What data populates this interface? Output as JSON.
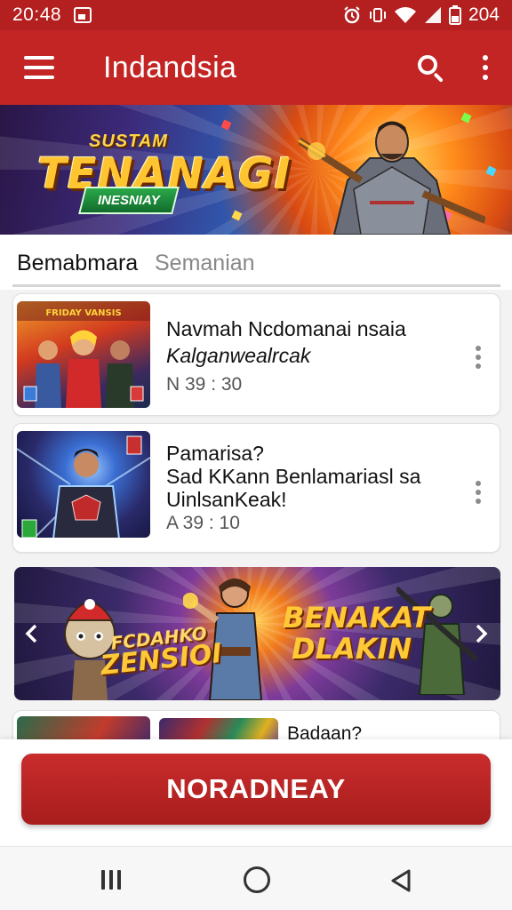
{
  "status_bar": {
    "time": "20:48",
    "battery": "204"
  },
  "app_bar": {
    "title": "Indandsia"
  },
  "hero": {
    "small_title": "SUSTAM",
    "big_title": "TENANAGI",
    "tag": "INESNIAY"
  },
  "section": {
    "title": "Bemabmara",
    "subtitle": "Semanian"
  },
  "cards": [
    {
      "title_line1": "Navmah Ncdomanai nsaia",
      "title_line2": "Kalganwealrcak",
      "meta": "N 39 : 30",
      "thumb_text": "FRIDAY VANSIS"
    },
    {
      "title_line1": "Pamarisa?",
      "title_line2": "Sad KKann Benlamariasl sa",
      "title_line3": "UinlsanKeak!",
      "meta": "A 39 : 10"
    }
  ],
  "promo": {
    "left_text_small": "FCDAHKO",
    "left_text_big": "ZENSIOI",
    "right_line1": "BENAKAT",
    "right_line2": "DLAKIN"
  },
  "partial_card": {
    "title": "Badaan?"
  },
  "cta": {
    "label": "NORADNEAY"
  },
  "colors": {
    "primary": "#c32424",
    "status": "#b41f1f",
    "accent_gold": "#ffc531"
  }
}
